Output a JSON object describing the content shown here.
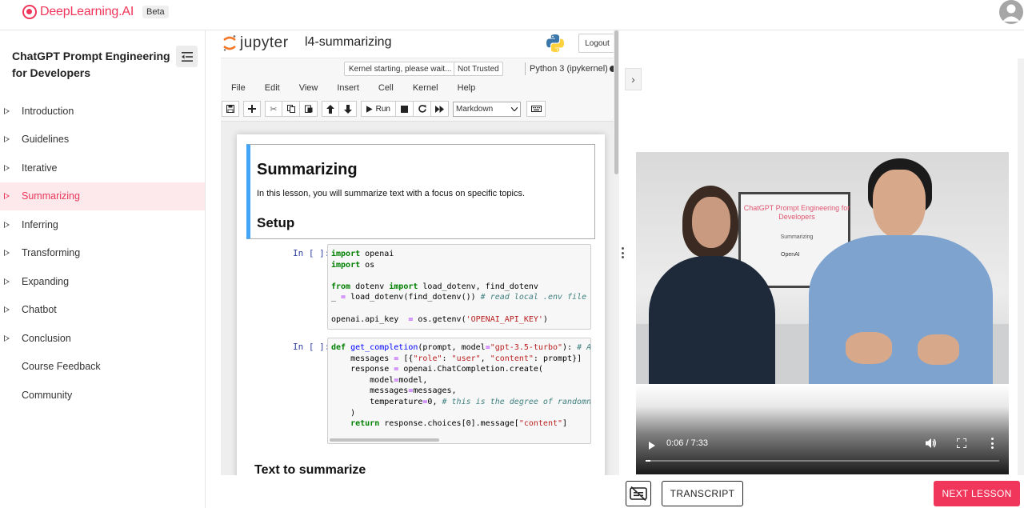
{
  "brand": {
    "name": "DeepLearning.AI",
    "badge": "Beta",
    "color": "#f0365a"
  },
  "sidebar": {
    "course_title": "ChatGPT Prompt Engineering for Developers",
    "items": [
      {
        "label": "Introduction",
        "has_arrow": true,
        "active": false
      },
      {
        "label": "Guidelines",
        "has_arrow": true,
        "active": false
      },
      {
        "label": "Iterative",
        "has_arrow": true,
        "active": false
      },
      {
        "label": "Summarizing",
        "has_arrow": true,
        "active": true
      },
      {
        "label": "Inferring",
        "has_arrow": true,
        "active": false
      },
      {
        "label": "Transforming",
        "has_arrow": true,
        "active": false
      },
      {
        "label": "Expanding",
        "has_arrow": true,
        "active": false
      },
      {
        "label": "Chatbot",
        "has_arrow": true,
        "active": false
      },
      {
        "label": "Conclusion",
        "has_arrow": true,
        "active": false
      },
      {
        "label": "Course Feedback",
        "has_arrow": false,
        "active": false
      },
      {
        "label": "Community",
        "has_arrow": false,
        "active": false
      }
    ]
  },
  "jupyter": {
    "logo_text": "jupyter",
    "notebook_name": "l4-summarizing",
    "logout_label": "Logout",
    "kernel_status": "Kernel starting, please wait...",
    "trust_status": "Not Trusted",
    "kernel_name": "Python 3 (ipykernel)",
    "menu": [
      "File",
      "Edit",
      "View",
      "Insert",
      "Cell",
      "Kernel",
      "Help"
    ],
    "toolbar": {
      "run_label": "Run",
      "cell_type": "Markdown"
    },
    "cells": {
      "heading": "Summarizing",
      "intro": "In this lesson, you will summarize text with a focus on specific topics.",
      "setup_heading": "Setup",
      "prompt_1": "In [ ]:",
      "prompt_2": "In [ ]:",
      "next_heading": "Text to summarize"
    }
  },
  "video": {
    "time": "0:06 / 7:33",
    "progress": 0.013,
    "screen_title": "ChatGPT Prompt Engineering for Developers",
    "screen_subtitle": "Summarizing",
    "screen_logo": "OpenAI"
  },
  "footer": {
    "transcript_label": "TRANSCRIPT",
    "next_label": "NEXT LESSON"
  }
}
